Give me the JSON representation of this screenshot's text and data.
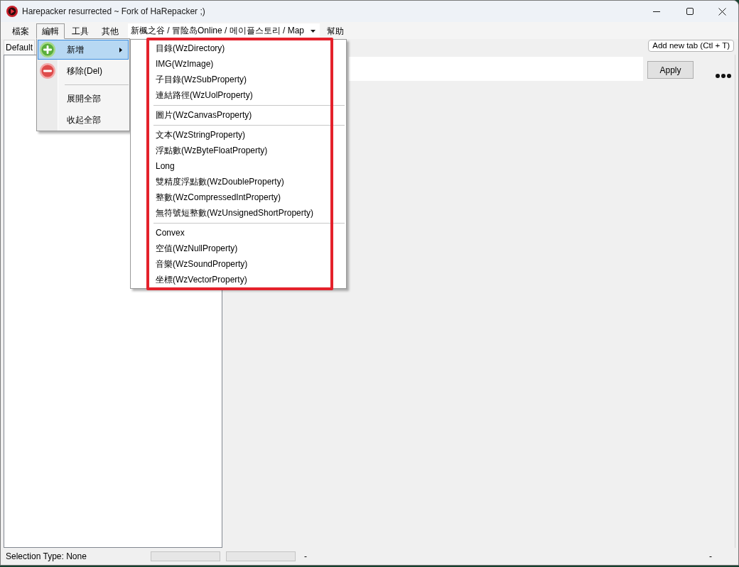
{
  "window": {
    "title": "Harepacker resurrected ~ Fork of HaRepacker ;)"
  },
  "menu_bar": {
    "items": [
      {
        "kind": "menu",
        "label": "檔案",
        "open": false
      },
      {
        "kind": "menu",
        "label": "編輯",
        "open": true,
        "dropdown": {
          "items": [
            {
              "kind": "add",
              "label": "新增",
              "selected": true,
              "submenu": {
                "highlighted": true,
                "items": [
                  {
                    "kind": "item",
                    "label": "目錄(WzDirectory)",
                    "selected": false
                  },
                  {
                    "kind": "item",
                    "label": "IMG(WzImage)",
                    "selected": false
                  },
                  {
                    "kind": "item",
                    "label": "子目錄(WzSubProperty)",
                    "selected": false
                  },
                  {
                    "kind": "item",
                    "label": "連結路徑(WzUolProperty)",
                    "selected": false
                  },
                  {
                    "kind": "separator"
                  },
                  {
                    "kind": "item",
                    "label": "圖片(WzCanvasProperty)",
                    "selected": false
                  },
                  {
                    "kind": "separator"
                  },
                  {
                    "kind": "item",
                    "label": "文本(WzStringProperty)",
                    "selected": false
                  },
                  {
                    "kind": "item",
                    "label": "浮點數(WzByteFloatProperty)",
                    "selected": false
                  },
                  {
                    "kind": "item",
                    "label": "Long",
                    "selected": false
                  },
                  {
                    "kind": "item",
                    "label": "雙精度浮點數(WzDoubleProperty)",
                    "selected": false
                  },
                  {
                    "kind": "item",
                    "label": "整數(WzCompressedIntProperty)",
                    "selected": false
                  },
                  {
                    "kind": "item",
                    "label": "無符號短整數(WzUnsignedShortProperty)",
                    "selected": false
                  },
                  {
                    "kind": "separator"
                  },
                  {
                    "kind": "item",
                    "label": "Convex",
                    "selected": false
                  },
                  {
                    "kind": "item",
                    "label": "空值(WzNullProperty)",
                    "selected": false
                  },
                  {
                    "kind": "item",
                    "label": "音樂(WzSoundProperty)",
                    "selected": false
                  },
                  {
                    "kind": "item",
                    "label": "坐標(WzVectorProperty)",
                    "selected": false
                  }
                ]
              }
            },
            {
              "kind": "remove",
              "label": "移除(Del)",
              "selected": false
            },
            {
              "kind": "separator"
            },
            {
              "kind": "item",
              "label": "展開全部",
              "selected": false
            },
            {
              "kind": "item",
              "label": "收起全部",
              "selected": false
            }
          ]
        }
      },
      {
        "kind": "menu",
        "label": "工具",
        "open": false
      },
      {
        "kind": "menu",
        "label": "其他",
        "open": false
      },
      {
        "kind": "combo",
        "value": "新楓之谷 / 冒险岛Online / 메이플스토리 / Map"
      },
      {
        "kind": "menu",
        "label": "幫助",
        "open": false
      }
    ]
  },
  "tabs": [
    {
      "label": "Default",
      "selected": true
    }
  ],
  "add_tab_button": {
    "label": "Add new tab (Ctl + T)"
  },
  "editor": {
    "apply_button": {
      "label": "Apply"
    }
  },
  "status_bar": {
    "items": [
      {
        "kind": "text",
        "text": "Selection Type: None"
      },
      {
        "kind": "progress",
        "level": 0
      },
      {
        "kind": "progress",
        "level": 0
      },
      {
        "kind": "text",
        "text": "-"
      },
      {
        "kind": "text",
        "text": "-"
      }
    ]
  }
}
